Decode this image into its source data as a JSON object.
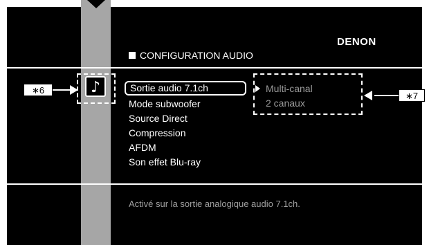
{
  "header": {
    "brand": "DENON",
    "title": "CONFIGURATION AUDIO"
  },
  "callouts": {
    "left_label": "∗6",
    "right_label": "∗7"
  },
  "menu": {
    "items": [
      {
        "label": "Sortie audio 7.1ch",
        "selected": true
      },
      {
        "label": "Mode subwoofer",
        "selected": false
      },
      {
        "label": "Source Direct",
        "selected": false
      },
      {
        "label": "Compression",
        "selected": false
      },
      {
        "label": "AFDM",
        "selected": false
      },
      {
        "label": "Son effet Blu-ray",
        "selected": false
      }
    ],
    "icon": "music-note-icon"
  },
  "options": [
    {
      "label": "Multi-canal"
    },
    {
      "label": "2 canaux"
    }
  ],
  "description": "Activé sur la sortie analogique audio 7.1ch.",
  "colors": {
    "background": "#000000",
    "column": "#a6a6a6",
    "text": "#ffffff",
    "muted_text": "#9a9a9a"
  }
}
